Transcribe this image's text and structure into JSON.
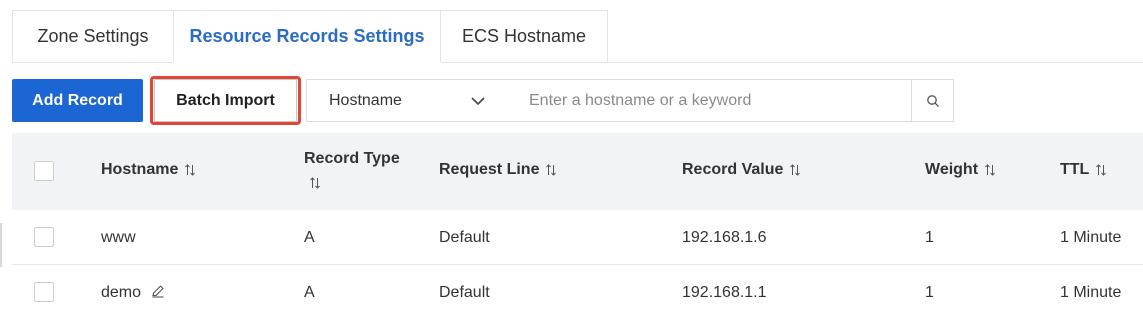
{
  "tabs": [
    {
      "label": "Zone Settings",
      "active": false
    },
    {
      "label": "Resource Records Settings",
      "active": true
    },
    {
      "label": "ECS Hostname",
      "active": false
    }
  ],
  "toolbar": {
    "add_label": "Add Record",
    "batch_label": "Batch Import",
    "filter_selected": "Hostname",
    "search_placeholder": "Enter a hostname or a keyword"
  },
  "table": {
    "headers": {
      "hostname": "Hostname",
      "record_type_line1": "Record Type",
      "request_line": "Request Line",
      "record_value": "Record Value",
      "weight": "Weight",
      "ttl": "TTL"
    },
    "rows": [
      {
        "hostname": "www",
        "type": "A",
        "line": "Default",
        "value": "192.168.1.6",
        "weight": "1",
        "ttl": "1 Minute"
      },
      {
        "hostname": "demo",
        "type": "A",
        "line": "Default",
        "value": "192.168.1.1",
        "weight": "1",
        "ttl": "1 Minute"
      }
    ]
  },
  "colors": {
    "accent": "#1b66d3",
    "active_tab_text": "#2b6cc4",
    "highlight": "#e04535",
    "header_bg": "#f1f3f7"
  },
  "icons": {
    "sort": "sort-icon",
    "search": "search-icon",
    "chevron": "chevron-down-icon",
    "edit": "edit-icon"
  }
}
